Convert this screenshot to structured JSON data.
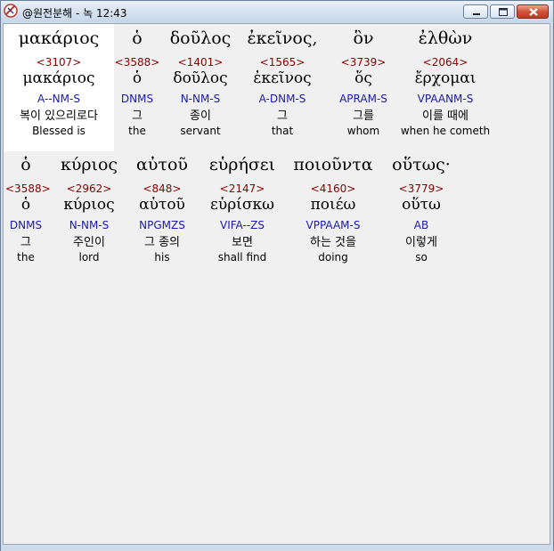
{
  "window": {
    "title": "@원전분해 - 녹 12:43",
    "icon": "app-logo-icon",
    "buttons": {
      "minimize": "minimize-icon",
      "maximize": "maximize-icon",
      "close": "close-icon"
    }
  },
  "verse_rows": [
    {
      "words": [
        {
          "greek": "μακάριος",
          "strong": "<3107>",
          "lemma": "μακάριος",
          "parse": "A--NM-S",
          "korean": "복이 있으리로다",
          "english": "Blessed is",
          "selected": true
        },
        {
          "greek": "ὁ",
          "strong": "<3588>",
          "lemma": "ὁ",
          "parse": "DNMS",
          "korean": "그",
          "english": "the"
        },
        {
          "greek": "δοῦλος",
          "strong": "<1401>",
          "lemma": "δοῦλος",
          "parse": "N-NM-S",
          "korean": "종이",
          "english": "servant"
        },
        {
          "greek": "ἐκεῖνος,",
          "strong": "<1565>",
          "lemma": "ἐκεῖνος",
          "parse": "A-DNM-S",
          "korean": "그",
          "english": "that"
        },
        {
          "greek": "ὃν",
          "strong": "<3739>",
          "lemma": "ὅς",
          "parse": "APRAM-S",
          "korean": "그를",
          "english": "whom"
        },
        {
          "greek": "ἐλθὼν",
          "strong": "<2064>",
          "lemma": "ἔρχομαι",
          "parse": "VPAANM-S",
          "korean": "이를 때에",
          "english": "when he cometh"
        }
      ]
    },
    {
      "words": [
        {
          "greek": "ὁ",
          "strong": "<3588>",
          "lemma": "ὁ",
          "parse": "DNMS",
          "korean": "그",
          "english": "the"
        },
        {
          "greek": "κύριος",
          "strong": "<2962>",
          "lemma": "κύριος",
          "parse": "N-NM-S",
          "korean": "주인이",
          "english": "lord"
        },
        {
          "greek": "αὐτοῦ",
          "strong": "<848>",
          "lemma": "αὑτοῦ",
          "parse": "NPGMZS",
          "korean": "그 종의",
          "english": "his"
        },
        {
          "greek": "εὑρήσει",
          "strong": "<2147>",
          "lemma": "εὑρίσκω",
          "parse": "VIFA--ZS",
          "korean": "보면",
          "english": "shall find"
        },
        {
          "greek": "ποιοῦντα",
          "strong": "<4160>",
          "lemma": "ποιέω",
          "parse": "VPPAAM-S",
          "korean": "하는 것을",
          "english": "doing"
        },
        {
          "greek": "οὕτως·",
          "strong": "<3779>",
          "lemma": "οὕτω",
          "parse": "AB",
          "korean": "이렇게",
          "english": "so"
        }
      ]
    }
  ],
  "colors": {
    "strong": "#8b0000",
    "parse": "#1a1ab0",
    "text": "#000000",
    "selection_bg": "#ffffff",
    "client_bg": "#f0f0f0"
  }
}
